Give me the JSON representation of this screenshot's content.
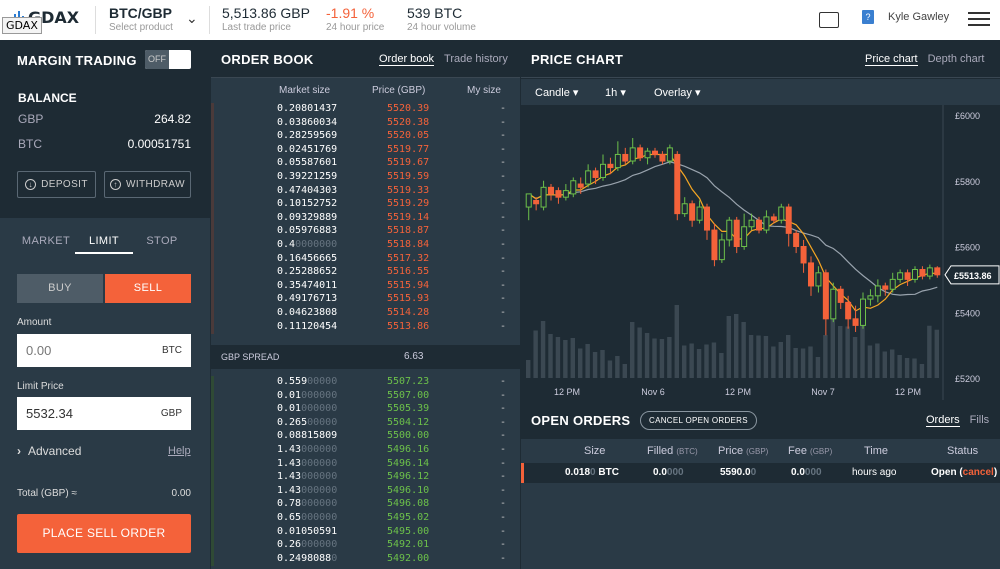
{
  "topbar": {
    "logo_text": "GDAX",
    "logo_tooltip": "GDAX",
    "product": "BTC/GBP",
    "product_sub": "Select product",
    "last_price": "5,513.86 GBP",
    "last_price_sub": "Last trade price",
    "change": "-1.91 %",
    "change_sub": "24 hour price",
    "volume": "539 BTC",
    "volume_sub": "24 hour volume",
    "user": "Kyle Gawley"
  },
  "margin": {
    "title": "MARGIN TRADING",
    "toggle": "OFF"
  },
  "balance": {
    "title": "BALANCE",
    "rows": [
      {
        "k": "GBP",
        "v": "264.82"
      },
      {
        "k": "BTC",
        "v": "0.00051751"
      }
    ],
    "deposit": "DEPOSIT",
    "withdraw": "WITHDRAW"
  },
  "order_form": {
    "types": [
      "MARKET",
      "LIMIT",
      "STOP"
    ],
    "buy": "BUY",
    "sell": "SELL",
    "amount_label": "Amount",
    "amount_value": "0.00",
    "amount_unit": "BTC",
    "limit_label": "Limit Price",
    "limit_value": "5532.34",
    "limit_unit": "GBP",
    "advanced": "Advanced",
    "help": "Help",
    "total_label": "Total (GBP) ≈",
    "total_value": "0.00",
    "place": "PLACE SELL ORDER"
  },
  "order_book": {
    "title": "ORDER BOOK",
    "tabs": [
      "Order book",
      "Trade history"
    ],
    "cols": [
      "Market size",
      "Price (GBP)",
      "My size"
    ],
    "asks": [
      [
        "0.20801437",
        "",
        "5520.39"
      ],
      [
        "0.03860034",
        "",
        "5520.38"
      ],
      [
        "0.28259569",
        "",
        "5520.05"
      ],
      [
        "0.02451769",
        "",
        "5519.77"
      ],
      [
        "0.05587601",
        "",
        "5519.67"
      ],
      [
        "0.39221259",
        "",
        "5519.59"
      ],
      [
        "0.47404303",
        "",
        "5519.33"
      ],
      [
        "0.10152752",
        "",
        "5519.29"
      ],
      [
        "0.09329889",
        "",
        "5519.14"
      ],
      [
        "0.05976883",
        "",
        "5518.87"
      ],
      [
        "0.4",
        "0000000",
        "5518.84"
      ],
      [
        "0.16456665",
        "",
        "5517.32"
      ],
      [
        "0.25288652",
        "",
        "5516.55"
      ],
      [
        "0.35474011",
        "",
        "5515.94"
      ],
      [
        "0.49176713",
        "",
        "5515.93"
      ],
      [
        "0.04623808",
        "",
        "5514.28"
      ],
      [
        "0.11120454",
        "",
        "5513.86"
      ]
    ],
    "spread_label": "GBP SPREAD",
    "spread_value": "6.63",
    "bids": [
      [
        "0.559",
        "00000",
        "5507.23"
      ],
      [
        "0.01",
        "000000",
        "5507.00"
      ],
      [
        "0.01",
        "000000",
        "5505.39"
      ],
      [
        "0.265",
        "00000",
        "5504.12"
      ],
      [
        "0.08815809",
        "",
        "5500.00"
      ],
      [
        "1.43",
        "000000",
        "5496.16"
      ],
      [
        "1.43",
        "000000",
        "5496.14"
      ],
      [
        "1.43",
        "000000",
        "5496.12"
      ],
      [
        "1.43",
        "000000",
        "5496.10"
      ],
      [
        "0.78",
        "000000",
        "5496.08"
      ],
      [
        "0.65",
        "000000",
        "5495.02"
      ],
      [
        "0.01050591",
        "",
        "5495.00"
      ],
      [
        "0.26",
        "000000",
        "5492.01"
      ],
      [
        "0.2498088",
        "0",
        "5492.00"
      ]
    ],
    "my_size": "-"
  },
  "price_chart": {
    "title": "PRICE CHART",
    "tabs": [
      "Price chart",
      "Depth chart"
    ],
    "controls": [
      "Candle",
      "1h",
      "Overlay"
    ],
    "y_ticks": [
      "£6000",
      "£5800",
      "£5600",
      "£5400",
      "£5200"
    ],
    "x_ticks": [
      "12 PM",
      "Nov 6",
      "12 PM",
      "Nov 7",
      "12 PM"
    ],
    "current_label": "£5513.86"
  },
  "chart_data": {
    "type": "candlestick",
    "ylim": [
      5200,
      6000
    ],
    "candles": [
      [
        5720,
        5760,
        5700,
        5680
      ],
      [
        5740,
        5730,
        5750,
        5710
      ],
      [
        5720,
        5780,
        5800,
        5710
      ],
      [
        5780,
        5760,
        5790,
        5740
      ],
      [
        5770,
        5750,
        5780,
        5730
      ],
      [
        5750,
        5770,
        5790,
        5740
      ],
      [
        5760,
        5800,
        5810,
        5750
      ],
      [
        5790,
        5780,
        5810,
        5760
      ],
      [
        5790,
        5830,
        5850,
        5780
      ],
      [
        5830,
        5810,
        5840,
        5790
      ],
      [
        5810,
        5850,
        5880,
        5800
      ],
      [
        5850,
        5840,
        5870,
        5820
      ],
      [
        5840,
        5880,
        5920,
        5830
      ],
      [
        5880,
        5860,
        5900,
        5850
      ],
      [
        5860,
        5900,
        5930,
        5850
      ],
      [
        5900,
        5870,
        5910,
        5860
      ],
      [
        5870,
        5890,
        5900,
        5850
      ],
      [
        5890,
        5880,
        5900,
        5870
      ],
      [
        5880,
        5860,
        5890,
        5850
      ],
      [
        5860,
        5900,
        5910,
        5850
      ],
      [
        5880,
        5700,
        5890,
        5680
      ],
      [
        5700,
        5730,
        5750,
        5690
      ],
      [
        5730,
        5680,
        5740,
        5660
      ],
      [
        5680,
        5720,
        5740,
        5670
      ],
      [
        5720,
        5650,
        5730,
        5620
      ],
      [
        5650,
        5560,
        5670,
        5540
      ],
      [
        5560,
        5620,
        5640,
        5550
      ],
      [
        5620,
        5680,
        5690,
        5600
      ],
      [
        5680,
        5600,
        5690,
        5580
      ],
      [
        5600,
        5660,
        5700,
        5590
      ],
      [
        5660,
        5680,
        5700,
        5650
      ],
      [
        5680,
        5650,
        5690,
        5640
      ],
      [
        5650,
        5690,
        5710,
        5640
      ],
      [
        5690,
        5680,
        5700,
        5670
      ],
      [
        5680,
        5720,
        5730,
        5670
      ],
      [
        5720,
        5640,
        5730,
        5600
      ],
      [
        5640,
        5600,
        5650,
        5580
      ],
      [
        5600,
        5550,
        5620,
        5520
      ],
      [
        5550,
        5480,
        5570,
        5450
      ],
      [
        5480,
        5520,
        5540,
        5460
      ],
      [
        5520,
        5380,
        5530,
        5330
      ],
      [
        5380,
        5470,
        5490,
        5370
      ],
      [
        5470,
        5430,
        5480,
        5410
      ],
      [
        5430,
        5380,
        5450,
        5350
      ],
      [
        5380,
        5360,
        5420,
        5340
      ],
      [
        5360,
        5440,
        5460,
        5350
      ],
      [
        5440,
        5450,
        5470,
        5420
      ],
      [
        5450,
        5480,
        5500,
        5430
      ],
      [
        5480,
        5470,
        5490,
        5450
      ],
      [
        5470,
        5500,
        5520,
        5460
      ],
      [
        5500,
        5520,
        5530,
        5490
      ],
      [
        5520,
        5500,
        5530,
        5480
      ],
      [
        5500,
        5530,
        5540,
        5490
      ],
      [
        5530,
        5510,
        5540,
        5500
      ],
      [
        5510,
        5535,
        5545,
        5500
      ],
      [
        5535,
        5513.86,
        5540,
        5505
      ]
    ]
  },
  "open_orders": {
    "title": "OPEN ORDERS",
    "cancel": "CANCEL OPEN ORDERS",
    "tabs": [
      "Orders",
      "Fills"
    ],
    "cols": [
      "Size",
      "Filled",
      "(BTC)",
      "Price",
      "(GBP)",
      "Fee",
      "(GBP)",
      "Time",
      "Status"
    ],
    "row": {
      "size": "0.018",
      "size_dim": "0",
      "size_unit": "BTC",
      "filled": "0.0",
      "filled_dim": "000",
      "price": "5590.0",
      "price_dim": "0",
      "fee": "0.0",
      "fee_dim": "000",
      "time": "hours ago",
      "status": "Open",
      "cancel": "cancel"
    }
  },
  "colors": {
    "ask": "#f4623a",
    "bid": "#6cc04a",
    "accent": "#f4623a",
    "bg": "#1e2b34",
    "panel": "#2a3a46"
  }
}
